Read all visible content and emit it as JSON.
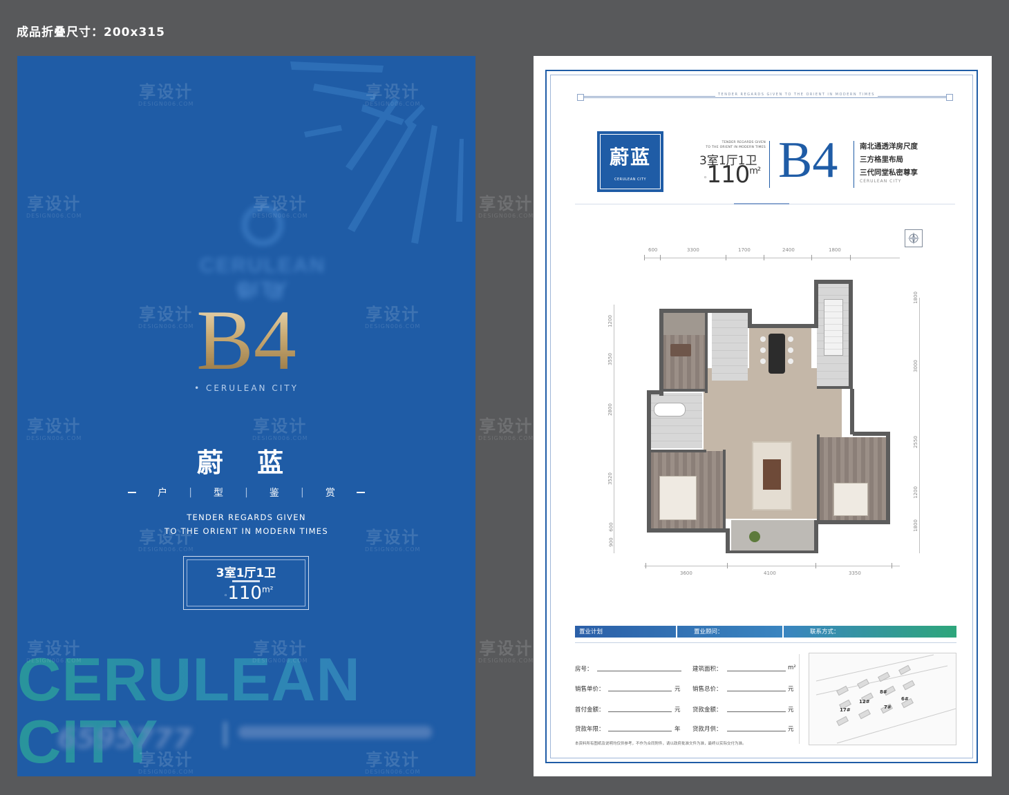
{
  "spec_label": "成品折叠尺寸：200x315",
  "watermark": {
    "cn": "享设计",
    "en": "DESIGN006.COM"
  },
  "cover": {
    "code": "B4",
    "sub": "• CERULEAN CITY",
    "title": "蔚 蓝",
    "tags": [
      "户",
      "型",
      "鉴",
      "赏"
    ],
    "en_line1": "TENDER REGARDS GIVEN",
    "en_line2": "TO THE ORIENT IN MODERN TIMES",
    "rooms": "3室1厅1卫",
    "area": "110",
    "area_unit": "m²",
    "big_text": "CERULEAN CITY",
    "phone": "6595777"
  },
  "sheet": {
    "top_line_text": "TENDER REGARDS GIVEN TO THE ORIENT IN MODERN TIMES",
    "badge_title": "蔚蓝",
    "badge_sub": "CERULEAN CITY",
    "header_en_1": "TENDER REGARDS GIVEN",
    "header_en_2": "TO THE ORIENT IN MODERN TIMES",
    "rooms": "3室1厅1卫",
    "area": "110",
    "area_unit": "m²",
    "code": "B4",
    "features": [
      "南北通透洋房尺度",
      "三方格里布局",
      "三代同堂私密尊享"
    ],
    "city": "CERULEAN CITY",
    "dims_top": [
      "600",
      "3300",
      "1700",
      "2400",
      "1800"
    ],
    "dims_bottom": [
      "3600",
      "4100",
      "3350"
    ],
    "dims_left": [
      "1200",
      "3550",
      "2800",
      "3520",
      "600",
      "900"
    ],
    "dims_right": [
      "1800",
      "3000",
      "2550",
      "1200",
      "1800"
    ]
  },
  "form": {
    "bar": [
      "置业计划",
      "置业顾问：",
      "联系方式："
    ],
    "fields": [
      {
        "label": "房号：",
        "unit": ""
      },
      {
        "label": "建筑面积：",
        "unit": "m²"
      },
      {
        "label": "销售单价：",
        "unit": "元"
      },
      {
        "label": "销售总价：",
        "unit": "元"
      },
      {
        "label": "首付金额：",
        "unit": "元"
      },
      {
        "label": "贷款金额：",
        "unit": "元"
      },
      {
        "label": "贷款年限：",
        "unit": "年"
      },
      {
        "label": "贷款月供：",
        "unit": "元"
      }
    ],
    "note": "本资料所有图纸及说明均仅供参考，不作为合同附件，请以政府批准文件为准，最终以实际交付为准。",
    "buildings": [
      "17#",
      "12#",
      "8#",
      "7#",
      "6#"
    ]
  },
  "colors": {
    "brand_blue": "#1f5ca6",
    "gold": "#c9aa73",
    "background": "#58595b"
  }
}
